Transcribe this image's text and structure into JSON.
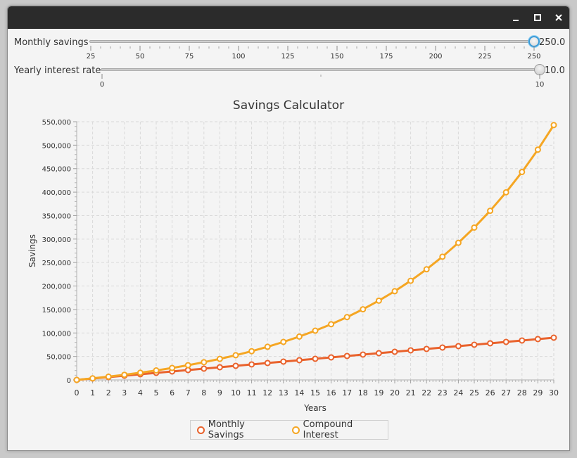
{
  "window": {
    "buttons": [
      "minimize",
      "maximize",
      "close"
    ]
  },
  "sliders": {
    "monthly": {
      "label": "Monthly savings",
      "value_text": "250.0",
      "value": 250,
      "min": 25,
      "max": 250,
      "tick_labels": [
        "25",
        "50",
        "75",
        "100",
        "125",
        "150",
        "175",
        "200",
        "225",
        "250"
      ]
    },
    "interest": {
      "label": "Yearly interest rate",
      "value_text": "10.0",
      "value": 10,
      "min": 0,
      "max": 10,
      "tick_labels": [
        "0",
        "10"
      ]
    }
  },
  "chart_data": {
    "type": "line",
    "title": "Savings Calculator",
    "xlabel": "Years",
    "ylabel": "Savings",
    "xlim": [
      0,
      30
    ],
    "ylim": [
      0,
      550000
    ],
    "x_ticks": [
      "0",
      "1",
      "2",
      "3",
      "4",
      "5",
      "6",
      "7",
      "8",
      "9",
      "10",
      "11",
      "12",
      "13",
      "14",
      "15",
      "16",
      "17",
      "18",
      "19",
      "20",
      "21",
      "22",
      "23",
      "24",
      "25",
      "26",
      "27",
      "28",
      "29",
      "30"
    ],
    "y_ticks": [
      "0",
      "50,000",
      "100,000",
      "150,000",
      "200,000",
      "250,000",
      "300,000",
      "350,000",
      "400,000",
      "450,000",
      "500,000",
      "550,000"
    ],
    "grid": true,
    "legend_position": "bottom",
    "x": [
      0,
      1,
      2,
      3,
      4,
      5,
      6,
      7,
      8,
      9,
      10,
      11,
      12,
      13,
      14,
      15,
      16,
      17,
      18,
      19,
      20,
      21,
      22,
      23,
      24,
      25,
      26,
      27,
      28,
      29,
      30
    ],
    "series": [
      {
        "name": "Monthly Savings",
        "color": "#e9622c",
        "values": [
          0,
          3000,
          6000,
          9000,
          12000,
          15000,
          18000,
          21000,
          24000,
          27000,
          30000,
          33000,
          36000,
          39000,
          42000,
          45000,
          48000,
          51000,
          54000,
          57000,
          60000,
          63000,
          66000,
          69000,
          72000,
          75000,
          78000,
          81000,
          84000,
          87000,
          90000
        ]
      },
      {
        "name": "Compound Interest",
        "color": "#f5a623",
        "values": [
          0,
          3300,
          6930,
          10923,
          15315,
          20147,
          25462,
          31308,
          37738,
          44812,
          52594,
          61153,
          70568,
          80925,
          92318,
          104849,
          118634,
          133798,
          150477,
          168825,
          189007,
          211208,
          235629,
          262492,
          292041,
          324545,
          360300,
          399630,
          442893,
          490482,
          542830
        ]
      }
    ]
  }
}
